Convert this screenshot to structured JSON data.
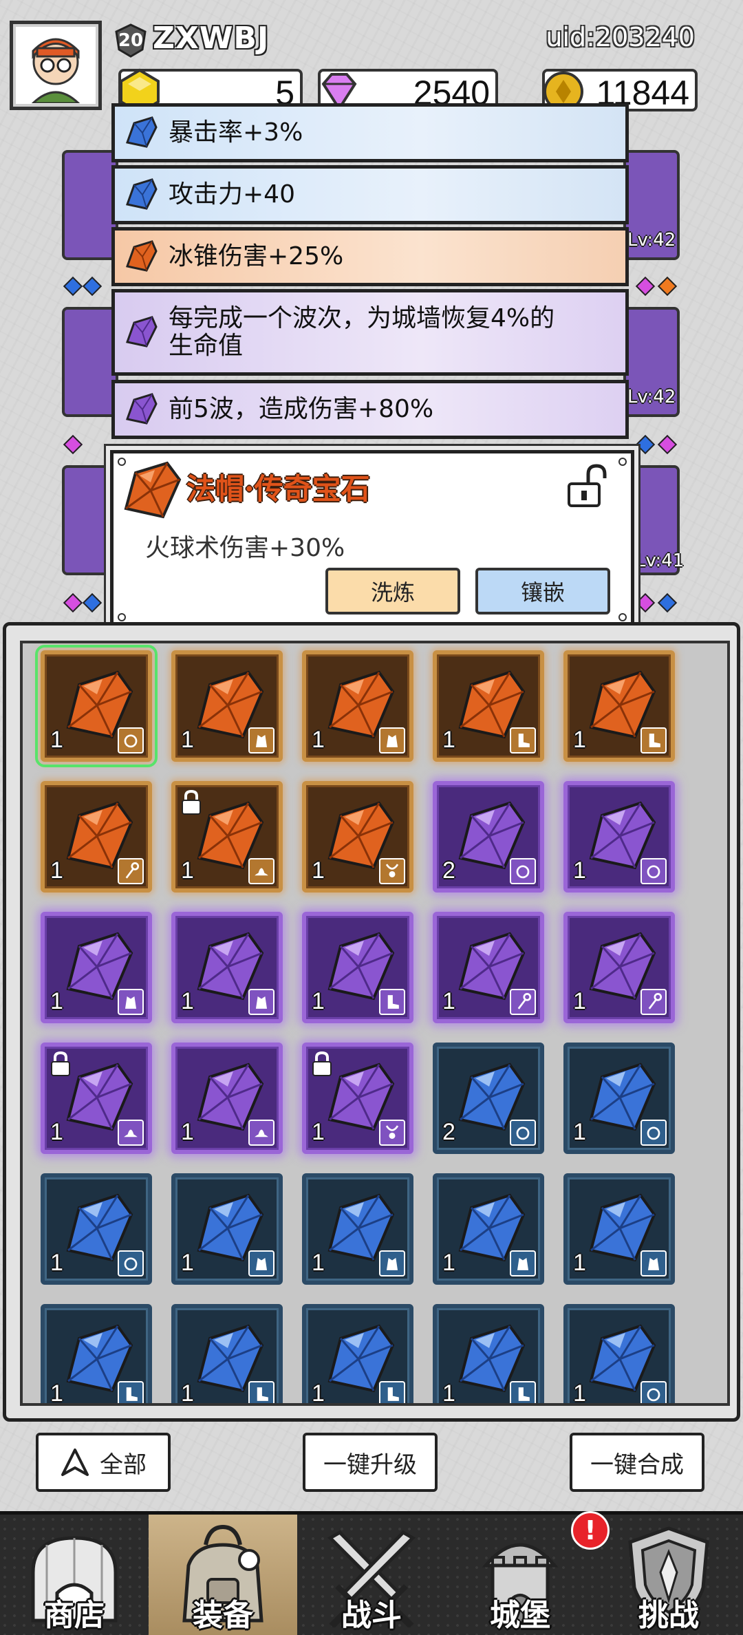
{
  "player": {
    "level": "20",
    "name": "ZXWBJ",
    "uid": "uid:203240"
  },
  "currencies": [
    {
      "name": "yellow-gem",
      "value": "5",
      "color": "#f2d21b"
    },
    {
      "name": "diamond",
      "value": "2540",
      "color": "#d97ef0"
    },
    {
      "name": "gold-coin",
      "value": "11844",
      "color": "#e6b41f"
    }
  ],
  "hero_cards": [
    {
      "level": "Lv:42"
    },
    {
      "level": "Lv:42"
    },
    {
      "level": "Lv:41"
    }
  ],
  "attributes": [
    {
      "text": "暴击率+3%",
      "tier": "blue"
    },
    {
      "text": "攻击力+40",
      "tier": "blue"
    },
    {
      "text": "冰锥伤害+25%",
      "tier": "orange"
    },
    {
      "text": "每完成一个波次，为城墙恢复4%的",
      "text2": "生命值",
      "tier": "purple"
    },
    {
      "text": "前5波，造成伤害+80%",
      "tier": "purple"
    }
  ],
  "gem_popup": {
    "title": "法帽·传奇宝石",
    "description": "火球术伤害+30%",
    "wash_button": "洗炼",
    "inlay_button": "镶嵌"
  },
  "inventory": [
    [
      {
        "tier": "orange",
        "count": "1",
        "part": "ring"
      },
      {
        "tier": "orange",
        "count": "1",
        "part": "robe"
      },
      {
        "tier": "orange",
        "count": "1",
        "part": "robe"
      },
      {
        "tier": "orange",
        "count": "1",
        "part": "boots"
      },
      {
        "tier": "orange",
        "count": "1",
        "part": "boots"
      }
    ],
    [
      {
        "tier": "orange",
        "count": "1",
        "part": "staff"
      },
      {
        "tier": "orange",
        "count": "1",
        "part": "hat",
        "locked": true
      },
      {
        "tier": "orange",
        "count": "1",
        "part": "amulet"
      },
      {
        "tier": "purple",
        "count": "2",
        "part": "ring"
      },
      {
        "tier": "purple",
        "count": "1",
        "part": "ring"
      }
    ],
    [
      {
        "tier": "purple",
        "count": "1",
        "part": "robe"
      },
      {
        "tier": "purple",
        "count": "1",
        "part": "robe"
      },
      {
        "tier": "purple",
        "count": "1",
        "part": "boots"
      },
      {
        "tier": "purple",
        "count": "1",
        "part": "staff"
      },
      {
        "tier": "purple",
        "count": "1",
        "part": "staff"
      }
    ],
    [
      {
        "tier": "purple",
        "count": "1",
        "part": "hat",
        "locked": true
      },
      {
        "tier": "purple",
        "count": "1",
        "part": "hat"
      },
      {
        "tier": "purple",
        "count": "1",
        "part": "amulet",
        "locked": true
      },
      {
        "tier": "blue",
        "count": "2",
        "part": "ring"
      },
      {
        "tier": "blue",
        "count": "1",
        "part": "ring"
      }
    ],
    [
      {
        "tier": "blue",
        "count": "1",
        "part": "ring"
      },
      {
        "tier": "blue",
        "count": "1",
        "part": "robe"
      },
      {
        "tier": "blue",
        "count": "1",
        "part": "robe"
      },
      {
        "tier": "blue",
        "count": "1",
        "part": "robe"
      },
      {
        "tier": "blue",
        "count": "1",
        "part": "robe"
      }
    ],
    [
      {
        "tier": "blue",
        "count": "1",
        "part": "boots"
      },
      {
        "tier": "blue",
        "count": "1",
        "part": "boots"
      },
      {
        "tier": "blue",
        "count": "1",
        "part": "boots"
      },
      {
        "tier": "blue",
        "count": "1",
        "part": "boots"
      },
      {
        "tier": "blue",
        "count": "1",
        "part": "ring"
      }
    ]
  ],
  "actions": {
    "filter": "全部",
    "upgrade_all": "一键升级",
    "merge_all": "一键合成"
  },
  "nav": [
    {
      "label": "商店",
      "icon": "shop-icon"
    },
    {
      "label": "装备",
      "icon": "bag-icon",
      "active": true
    },
    {
      "label": "战斗",
      "icon": "swords-icon"
    },
    {
      "label": "城堡",
      "icon": "castle-icon"
    },
    {
      "label": "挑战",
      "icon": "shield-icon"
    }
  ],
  "notification_badge": "!",
  "colors": {
    "legendary": "#c89044",
    "epic": "#9a66d7",
    "rare": "#2b4a66",
    "selected": "#58e36a",
    "title": "#e0531a"
  }
}
